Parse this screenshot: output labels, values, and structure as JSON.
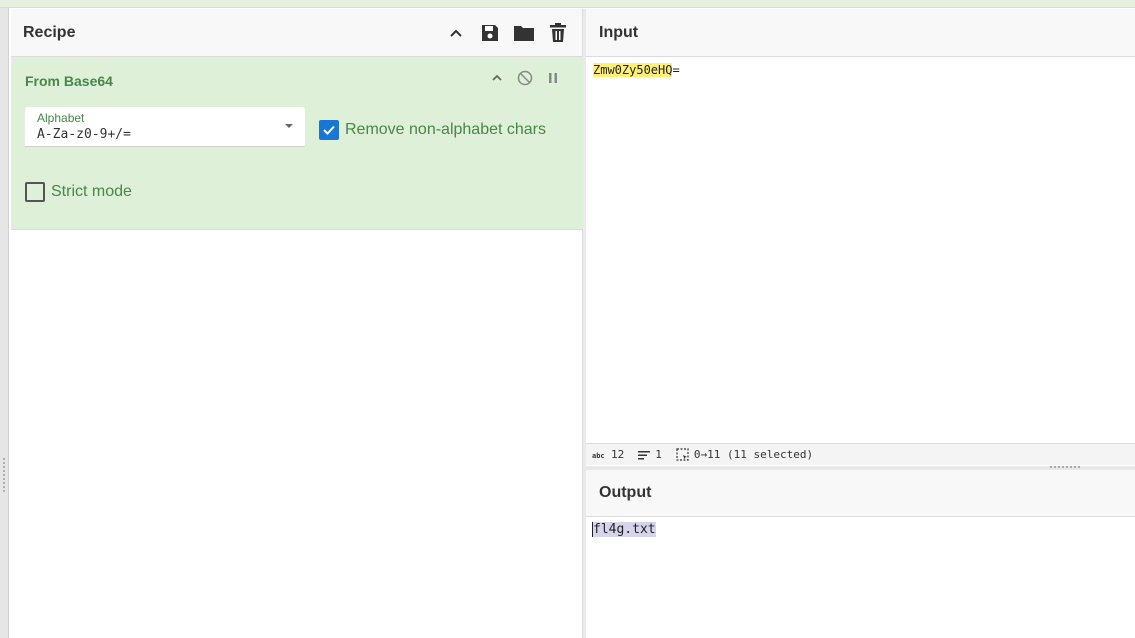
{
  "recipe": {
    "title": "Recipe",
    "operation": {
      "name": "From Base64",
      "alphabet": {
        "label": "Alphabet",
        "value": "A-Za-z0-9+/="
      },
      "remove_non_alphabet": {
        "label": "Remove non-alphabet chars",
        "checked": true
      },
      "strict_mode": {
        "label": "Strict mode",
        "checked": false
      }
    }
  },
  "input": {
    "title": "Input",
    "text_highlighted": "Zmw0Zy50eHQ",
    "text_rest": "=",
    "status": {
      "length": "12",
      "lines": "1",
      "selection": "0→11 (11 selected)"
    }
  },
  "output": {
    "title": "Output",
    "text": "fl4g.txt"
  },
  "colors": {
    "recipe_bg": "#dff0d8",
    "op_title": "#468847",
    "checkbox_checked": "#1976d2",
    "input_highlight": "#fff176",
    "output_highlight": "#d6d4ec"
  }
}
